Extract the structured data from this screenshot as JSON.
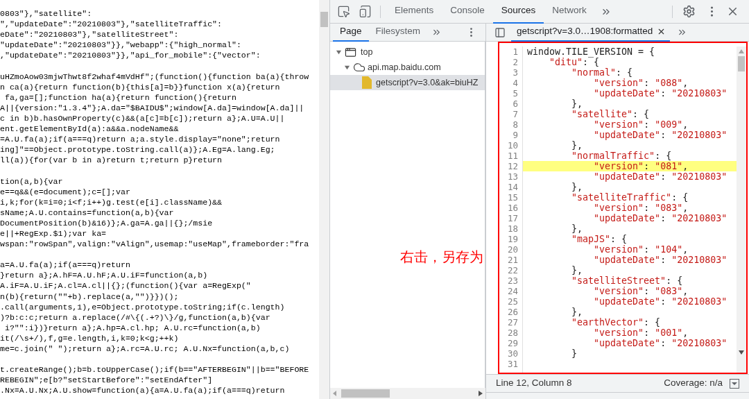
{
  "page_source": {
    "blocks": [
      [
        "0803\"},\"satellite\":",
        "\",\"updateDate\":\"20210803\"},\"satelliteTraffic\":",
        "eDate\":\"20210803\"},\"satelliteStreet\":",
        "\"updateDate\":\"20210803\"}},\"webapp\":{\"high_normal\":",
        ",\"updateDate\":\"20210803\"}},\"api_for_mobile\":{\"vector\":"
      ],
      [
        "uHZmoAow03mjwThwt8f2whaf4mVdHf\";(function(){function ba(a){throw",
        "n ca(a){return function(b){this[a]=b}}function x(a){return",
        " fa,ga=[];function ha(a){return function(){return",
        "A||{version:\"1.3.4\"};A.da=\"$BAIDU$\";window[A.da]=window[A.da]||",
        "c in b)b.hasOwnProperty(c)&&(a[c]=b[c]);return a};A.U=A.U||",
        "ent.getElementById(a):a&&a.nodeName&&",
        "=A.U.fa(a);if(a===q)return a;a.style.display=\"none\";return",
        "ing]\"==Object.prototype.toString.call(a)};A.Eg=A.lang.Eg;",
        "ll(a)){for(var b in a)return t;return p}return"
      ],
      [
        "tion(a,b){var",
        "e==q&&(e=document);c=[];var",
        "i,k;for(k=i=0;i<f;i++)g.test(e[i].className)&&",
        "sName;A.U.contains=function(a,b){var",
        "DocumentPosition(b)&16)};A.ga=A.ga||{};/msie",
        "e||+RegExp.$1);var ka=",
        "wspan:\"rowSpan\",valign:\"vAlign\",usemap:\"useMap\",frameborder:\"fra"
      ],
      [
        "a=A.U.fa(a);if(a===q)return",
        "}return a};A.hF=A.U.hF;A.U.iF=function(a,b)",
        "A.iF=A.U.iF;A.cl=A.cl||{};(function(){var a=RegExp(\"",
        "n(b){return(\"\"+b).replace(a,\"\")}})();",
        ".call(arguments,1),e=Object.prototype.toString;if(c.length)",
        ")?b:c:c;return a.replace(/#\\{(.+?)\\}/g,function(a,b){var",
        " i?\"\":i})}return a};A.hp=A.cl.hp; A.U.rc=function(a,b)",
        "it(/\\s+/),f,g=e.length,i,k=0;k<g;++k)",
        "me=c.join(\" \");return a};A.rc=A.U.rc; A.U.Nx=function(a,b,c)"
      ],
      [
        "t.createRange();b=b.toUpperCase();if(b==\"AFTERBEGIN\"||b==\"BEFORE",
        "REBEGIN\";e[b?\"setStartBefore\":\"setEndAfter\"]",
        ".Nx=A.U.Nx;A.U.show=function(a){a=A.U.fa(a);if(a===q)return"
      ]
    ]
  },
  "devtools": {
    "main_tabs": [
      {
        "label": "Elements",
        "selected": false
      },
      {
        "label": "Console",
        "selected": false
      },
      {
        "label": "Sources",
        "selected": true
      },
      {
        "label": "Network",
        "selected": false
      }
    ],
    "navigator": {
      "tabs": [
        {
          "label": "Page",
          "selected": true
        },
        {
          "label": "Filesystem",
          "selected": false
        }
      ],
      "tree": [
        {
          "label": "top",
          "kind": "frame",
          "expanded": true,
          "selected": false,
          "children": [
            {
              "label": "api.map.baidu.com",
              "kind": "domain",
              "expanded": true,
              "selected": false,
              "children": [
                {
                  "label": "getscript?v=3.0&ak=biuHZ",
                  "kind": "file",
                  "selected": true
                }
              ]
            }
          ]
        }
      ]
    },
    "editor": {
      "tab": {
        "label": "getscript?v=3.0…1908:formatted"
      },
      "lines": [
        {
          "number": "1",
          "highlighted": false,
          "tokens": [
            {
              "kind": "punct",
              "text": "window.TILE_VERSION = {"
            }
          ],
          "children": [
            {
              "number": "2",
              "highlighted": false,
              "tokens": [
                {
                  "kind": "string",
                  "text": "\"ditu\""
                },
                {
                  "kind": "punct",
                  "text": ": {"
                }
              ],
              "children": [
                {
                  "number": "3",
                  "highlighted": false,
                  "tokens": [
                    {
                      "kind": "string",
                      "text": "\"normal\""
                    },
                    {
                      "kind": "punct",
                      "text": ": {"
                    }
                  ],
                  "children": [
                    {
                      "number": "4",
                      "highlighted": false,
                      "tokens": [
                        {
                          "kind": "string",
                          "text": "\"version\""
                        },
                        {
                          "kind": "punct",
                          "text": ": "
                        },
                        {
                          "kind": "string",
                          "text": "\"088\""
                        },
                        {
                          "kind": "punct",
                          "text": ","
                        }
                      ]
                    },
                    {
                      "number": "5",
                      "highlighted": false,
                      "tokens": [
                        {
                          "kind": "string",
                          "text": "\"updateDate\""
                        },
                        {
                          "kind": "punct",
                          "text": ": "
                        },
                        {
                          "kind": "string",
                          "text": "\"20210803\""
                        }
                      ]
                    }
                  ]
                },
                {
                  "number": "6",
                  "highlighted": false,
                  "tokens": [
                    {
                      "kind": "punct",
                      "text": "},"
                    }
                  ]
                },
                {
                  "number": "7",
                  "highlighted": false,
                  "tokens": [
                    {
                      "kind": "string",
                      "text": "\"satellite\""
                    },
                    {
                      "kind": "punct",
                      "text": ": {"
                    }
                  ],
                  "children": [
                    {
                      "number": "8",
                      "highlighted": false,
                      "tokens": [
                        {
                          "kind": "string",
                          "text": "\"version\""
                        },
                        {
                          "kind": "punct",
                          "text": ": "
                        },
                        {
                          "kind": "string",
                          "text": "\"009\""
                        },
                        {
                          "kind": "punct",
                          "text": ","
                        }
                      ]
                    },
                    {
                      "number": "9",
                      "highlighted": false,
                      "tokens": [
                        {
                          "kind": "string",
                          "text": "\"updateDate\""
                        },
                        {
                          "kind": "punct",
                          "text": ": "
                        },
                        {
                          "kind": "string",
                          "text": "\"20210803\""
                        }
                      ]
                    }
                  ]
                },
                {
                  "number": "10",
                  "highlighted": false,
                  "tokens": [
                    {
                      "kind": "punct",
                      "text": "},"
                    }
                  ]
                },
                {
                  "number": "11",
                  "highlighted": false,
                  "tokens": [
                    {
                      "kind": "string",
                      "text": "\"normalTraffic\""
                    },
                    {
                      "kind": "punct",
                      "text": ": {"
                    }
                  ],
                  "children": [
                    {
                      "number": "12",
                      "highlighted": true,
                      "tokens": [
                        {
                          "kind": "string",
                          "text": "\"version\""
                        },
                        {
                          "kind": "punct",
                          "text": ": "
                        },
                        {
                          "kind": "string",
                          "text": "\"081\""
                        },
                        {
                          "kind": "punct",
                          "text": ","
                        }
                      ]
                    },
                    {
                      "number": "13",
                      "highlighted": false,
                      "tokens": [
                        {
                          "kind": "string",
                          "text": "\"updateDate\""
                        },
                        {
                          "kind": "punct",
                          "text": ": "
                        },
                        {
                          "kind": "string",
                          "text": "\"20210803\""
                        }
                      ]
                    }
                  ]
                },
                {
                  "number": "14",
                  "highlighted": false,
                  "tokens": [
                    {
                      "kind": "punct",
                      "text": "},"
                    }
                  ]
                },
                {
                  "number": "15",
                  "highlighted": false,
                  "tokens": [
                    {
                      "kind": "string",
                      "text": "\"satelliteTraffic\""
                    },
                    {
                      "kind": "punct",
                      "text": ": {"
                    }
                  ],
                  "children": [
                    {
                      "number": "16",
                      "highlighted": false,
                      "tokens": [
                        {
                          "kind": "string",
                          "text": "\"version\""
                        },
                        {
                          "kind": "punct",
                          "text": ": "
                        },
                        {
                          "kind": "string",
                          "text": "\"083\""
                        },
                        {
                          "kind": "punct",
                          "text": ","
                        }
                      ]
                    },
                    {
                      "number": "17",
                      "highlighted": false,
                      "tokens": [
                        {
                          "kind": "string",
                          "text": "\"updateDate\""
                        },
                        {
                          "kind": "punct",
                          "text": ": "
                        },
                        {
                          "kind": "string",
                          "text": "\"20210803\""
                        }
                      ]
                    }
                  ]
                },
                {
                  "number": "18",
                  "highlighted": false,
                  "tokens": [
                    {
                      "kind": "punct",
                      "text": "},"
                    }
                  ]
                },
                {
                  "number": "19",
                  "highlighted": false,
                  "tokens": [
                    {
                      "kind": "string",
                      "text": "\"mapJS\""
                    },
                    {
                      "kind": "punct",
                      "text": ": {"
                    }
                  ],
                  "children": [
                    {
                      "number": "20",
                      "highlighted": false,
                      "tokens": [
                        {
                          "kind": "string",
                          "text": "\"version\""
                        },
                        {
                          "kind": "punct",
                          "text": ": "
                        },
                        {
                          "kind": "string",
                          "text": "\"104\""
                        },
                        {
                          "kind": "punct",
                          "text": ","
                        }
                      ]
                    },
                    {
                      "number": "21",
                      "highlighted": false,
                      "tokens": [
                        {
                          "kind": "string",
                          "text": "\"updateDate\""
                        },
                        {
                          "kind": "punct",
                          "text": ": "
                        },
                        {
                          "kind": "string",
                          "text": "\"20210803\""
                        }
                      ]
                    }
                  ]
                },
                {
                  "number": "22",
                  "highlighted": false,
                  "tokens": [
                    {
                      "kind": "punct",
                      "text": "},"
                    }
                  ]
                },
                {
                  "number": "23",
                  "highlighted": false,
                  "tokens": [
                    {
                      "kind": "string",
                      "text": "\"satelliteStreet\""
                    },
                    {
                      "kind": "punct",
                      "text": ": {"
                    }
                  ],
                  "children": [
                    {
                      "number": "24",
                      "highlighted": false,
                      "tokens": [
                        {
                          "kind": "string",
                          "text": "\"version\""
                        },
                        {
                          "kind": "punct",
                          "text": ": "
                        },
                        {
                          "kind": "string",
                          "text": "\"083\""
                        },
                        {
                          "kind": "punct",
                          "text": ","
                        }
                      ]
                    },
                    {
                      "number": "25",
                      "highlighted": false,
                      "tokens": [
                        {
                          "kind": "string",
                          "text": "\"updateDate\""
                        },
                        {
                          "kind": "punct",
                          "text": ": "
                        },
                        {
                          "kind": "string",
                          "text": "\"20210803\""
                        }
                      ]
                    }
                  ]
                },
                {
                  "number": "26",
                  "highlighted": false,
                  "tokens": [
                    {
                      "kind": "punct",
                      "text": "},"
                    }
                  ]
                },
                {
                  "number": "27",
                  "highlighted": false,
                  "tokens": [
                    {
                      "kind": "string",
                      "text": "\"earthVector\""
                    },
                    {
                      "kind": "punct",
                      "text": ": {"
                    }
                  ],
                  "children": [
                    {
                      "number": "28",
                      "highlighted": false,
                      "tokens": [
                        {
                          "kind": "string",
                          "text": "\"version\""
                        },
                        {
                          "kind": "punct",
                          "text": ": "
                        },
                        {
                          "kind": "string",
                          "text": "\"001\""
                        },
                        {
                          "kind": "punct",
                          "text": ","
                        }
                      ]
                    },
                    {
                      "number": "29",
                      "highlighted": false,
                      "tokens": [
                        {
                          "kind": "string",
                          "text": "\"updateDate\""
                        },
                        {
                          "kind": "punct",
                          "text": ": "
                        },
                        {
                          "kind": "string",
                          "text": "\"20210803\""
                        }
                      ]
                    }
                  ]
                },
                {
                  "number": "30",
                  "highlighted": false,
                  "tokens": [
                    {
                      "kind": "punct",
                      "text": "}"
                    }
                  ]
                }
              ]
            }
          ]
        },
        {
          "number": "31",
          "highlighted": false
        }
      ]
    },
    "status_bar": {
      "position": "Line 12, Column 8",
      "coverage": "Coverage: n/a"
    }
  },
  "annotation": {
    "text": "右击，另存为"
  }
}
